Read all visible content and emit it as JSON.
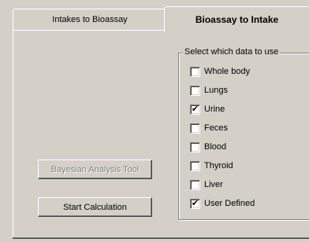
{
  "tabs": [
    {
      "label": "Intakes to Bioassay",
      "active": false
    },
    {
      "label": "Bioassay to Intake",
      "active": true
    }
  ],
  "data_selection": {
    "legend": "Select which data to use",
    "options": [
      {
        "label": "Whole body",
        "checked": false
      },
      {
        "label": "Lungs",
        "checked": false
      },
      {
        "label": "Urine",
        "checked": true
      },
      {
        "label": "Feces",
        "checked": false
      },
      {
        "label": "Blood",
        "checked": false
      },
      {
        "label": "Thyroid",
        "checked": false
      },
      {
        "label": "Liver",
        "checked": false
      },
      {
        "label": "User Defined",
        "checked": true
      }
    ]
  },
  "buttons": {
    "bayesian_label": "Bayesian Analysis Tool",
    "bayesian_enabled": false,
    "start_label": "Start Calculation"
  }
}
